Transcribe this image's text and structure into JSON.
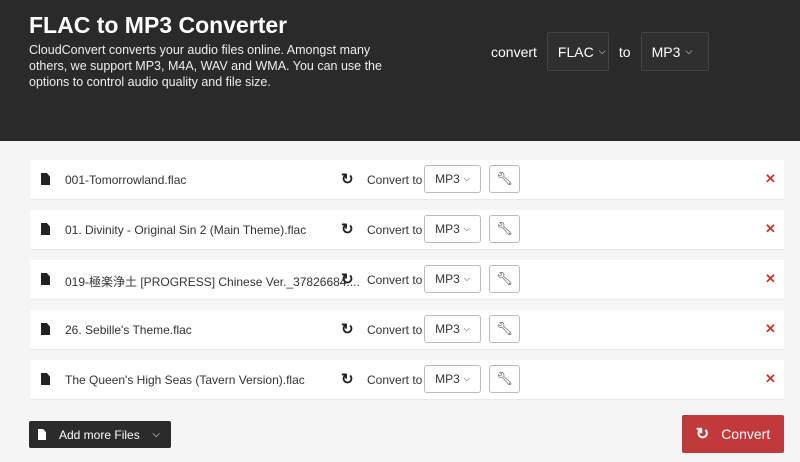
{
  "header": {
    "title": "FLAC to MP3 Converter",
    "description": "CloudConvert converts your audio files online. Amongst many others, we support MP3, M4A, WAV and WMA. You can use the options to control audio quality and file size.",
    "convert_label": "convert",
    "from": "FLAC",
    "to_label": "to",
    "to": "MP3"
  },
  "files": [
    {
      "name": "001-Tomorrowland.flac",
      "convert_to": "Convert to",
      "format": "MP3"
    },
    {
      "name": "01. Divinity - Original Sin 2 (Main Theme).flac",
      "convert_to": "Convert to",
      "format": "MP3"
    },
    {
      "name": "019-極楽浄土 [PROGRESS] Chinese Ver._37826684....",
      "convert_to": "Convert to",
      "format": "MP3"
    },
    {
      "name": "26. Sebille's Theme.flac",
      "convert_to": "Convert to",
      "format": "MP3"
    },
    {
      "name": "The Queen's High Seas (Tavern Version).flac",
      "convert_to": "Convert to",
      "format": "MP3"
    }
  ],
  "footer": {
    "add_label": "Add more Files",
    "convert_label": "Convert"
  },
  "colors": {
    "header_bg": "#2a2a2b",
    "accent": "#c0393b"
  }
}
